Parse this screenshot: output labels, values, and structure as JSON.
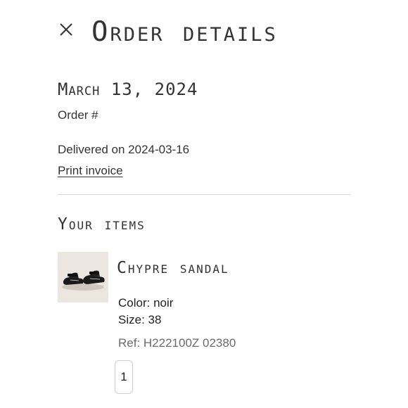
{
  "header": {
    "close_icon": "close-icon",
    "title": "Order details"
  },
  "order": {
    "date": "March 13, 2024",
    "number_label": "Order #",
    "number_value": "",
    "delivery_status": "Delivered on 2024-03-16",
    "print_invoice_label": "Print invoice"
  },
  "items_section": {
    "heading": "Your items",
    "items": [
      {
        "name": "Chypre sandal",
        "image_icon": "sandal-product-image",
        "color_line": "Color: noir",
        "size_line": "Size: 38",
        "ref_line": "Ref: H222100Z 02380",
        "quantity": "1"
      }
    ]
  },
  "colors": {
    "text": "#333333",
    "muted_text": "#6b6b6b",
    "divider": "#d9d9d9",
    "image_background": "#ebe6df",
    "product": "#1a1a1a"
  }
}
